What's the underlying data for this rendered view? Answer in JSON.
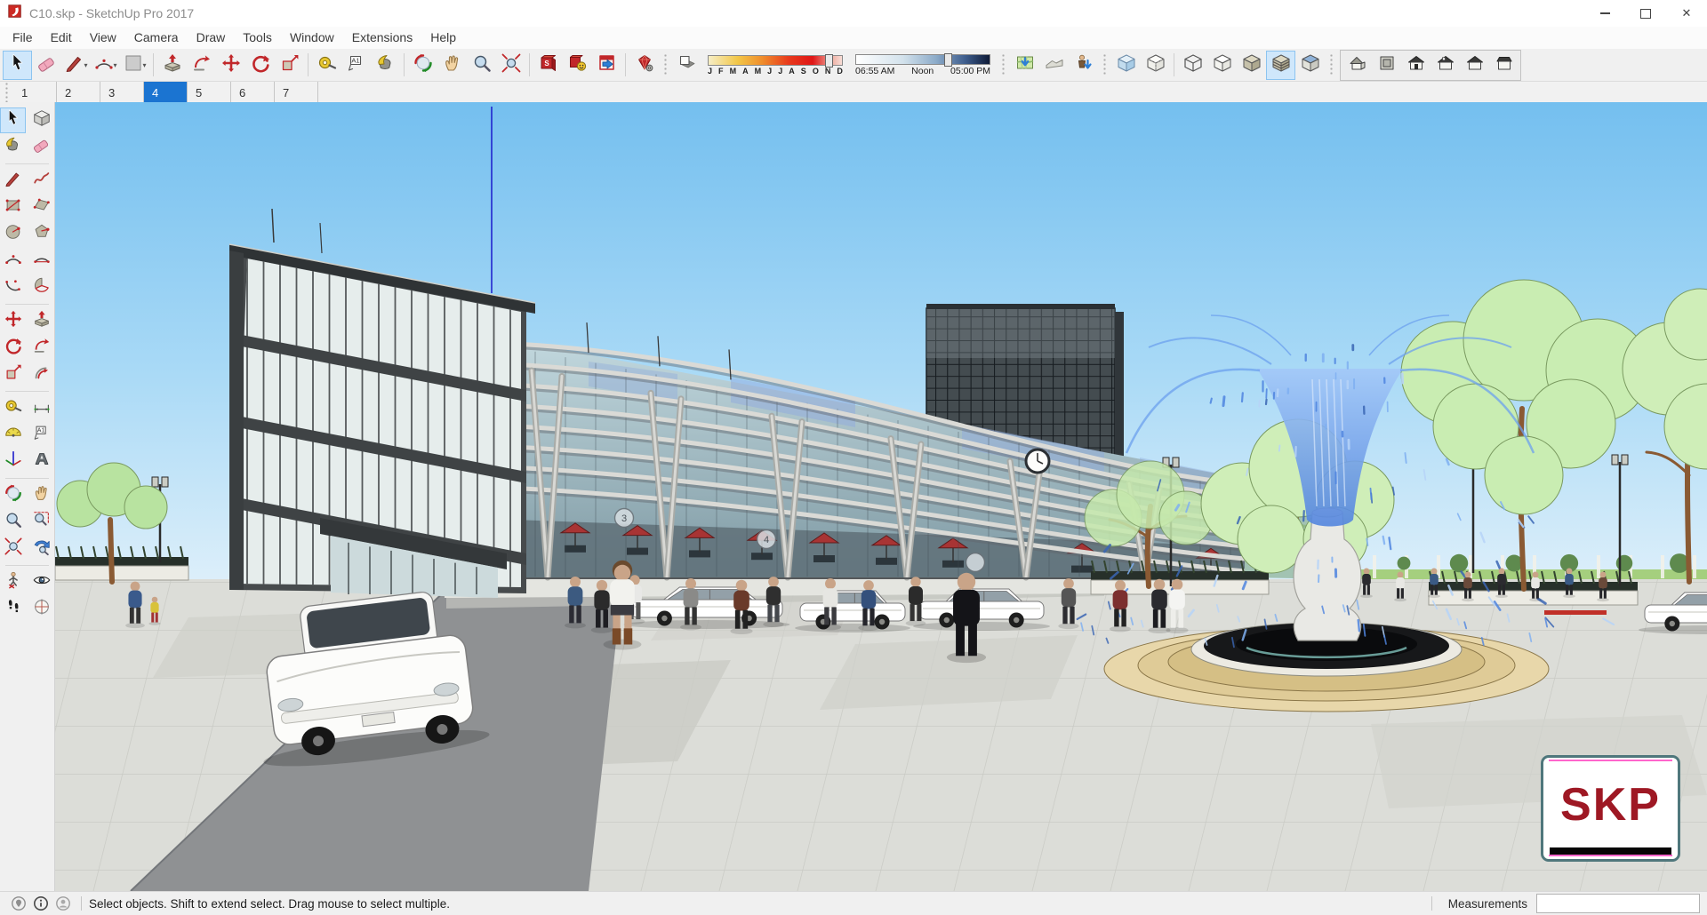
{
  "window": {
    "title": "C10.skp - SketchUp Pro 2017"
  },
  "menu": {
    "items": [
      "File",
      "Edit",
      "View",
      "Camera",
      "Draw",
      "Tools",
      "Window",
      "Extensions",
      "Help"
    ]
  },
  "toolbar": {
    "layout": [
      "select*",
      "eraser",
      "line+",
      "arc+",
      "shapes+",
      "|",
      "push-pull",
      "follow-me",
      "move",
      "rotate",
      "scale",
      "|",
      "tape-measure",
      "text",
      "paint-bucket",
      "|",
      "orbit",
      "pan",
      "zoom",
      "zoom-extents",
      "|",
      "wh-model",
      "share-model",
      "ext-warehouse",
      "|",
      "ruby-gear",
      "::",
      "shadow-toggle",
      "@date",
      "@time",
      "::",
      "add-location",
      "toggle-terrain",
      "photo-textures",
      "::",
      "xray",
      "back-edges",
      "|",
      "wireframe",
      "hidden-line",
      "shaded",
      "shaded-textures*",
      "monochrome",
      "::",
      "{",
      "view-iso",
      "view-top",
      "view-front",
      "view-right",
      "view-back",
      "view-left",
      "}"
    ],
    "shadows": {
      "months": [
        "J",
        "F",
        "M",
        "A",
        "M",
        "J",
        "J",
        "A",
        "S",
        "O",
        "N",
        "D"
      ],
      "date_pos": 0.87,
      "time_start": "06:55 AM",
      "time_noon": "Noon",
      "time_end": "05:00 PM",
      "time_pos": 0.66
    }
  },
  "scene_tabs": {
    "labels": [
      "1",
      "2",
      "3",
      "4",
      "5",
      "6",
      "7"
    ],
    "active": "4"
  },
  "left_toolbar": {
    "rows": [
      [
        "select*",
        "make-component"
      ],
      [
        "paint-bucket",
        "eraser"
      ],
      [
        "—"
      ],
      [
        "line",
        "freehand"
      ],
      [
        "rectangle",
        "rotated-rectangle"
      ],
      [
        "circle",
        "polygon"
      ],
      [
        "arc",
        "two-point-arc"
      ],
      [
        "three-point-arc",
        "pie"
      ],
      [
        "—"
      ],
      [
        "move",
        "push-pull"
      ],
      [
        "rotate",
        "follow-me"
      ],
      [
        "scale",
        "offset"
      ],
      [
        "—"
      ],
      [
        "tape-measure",
        "dimension"
      ],
      [
        "protractor",
        "text"
      ],
      [
        "axes",
        "text3d"
      ],
      [
        "—"
      ],
      [
        "orbit",
        "pan"
      ],
      [
        "zoom",
        "zoom-window"
      ],
      [
        "zoom-extents",
        "zoom-previous"
      ],
      [
        "—"
      ],
      [
        "position-camera",
        "look-around"
      ],
      [
        "walk",
        "section-plane"
      ]
    ]
  },
  "viewport": {
    "gate_labels": [
      "3",
      "4"
    ]
  },
  "watermark": {
    "text": "SKP"
  },
  "status_bar": {
    "hint": "Select objects. Shift to extend select. Drag mouse to select multiple.",
    "measurements_label": "Measurements",
    "measurements_value": ""
  }
}
